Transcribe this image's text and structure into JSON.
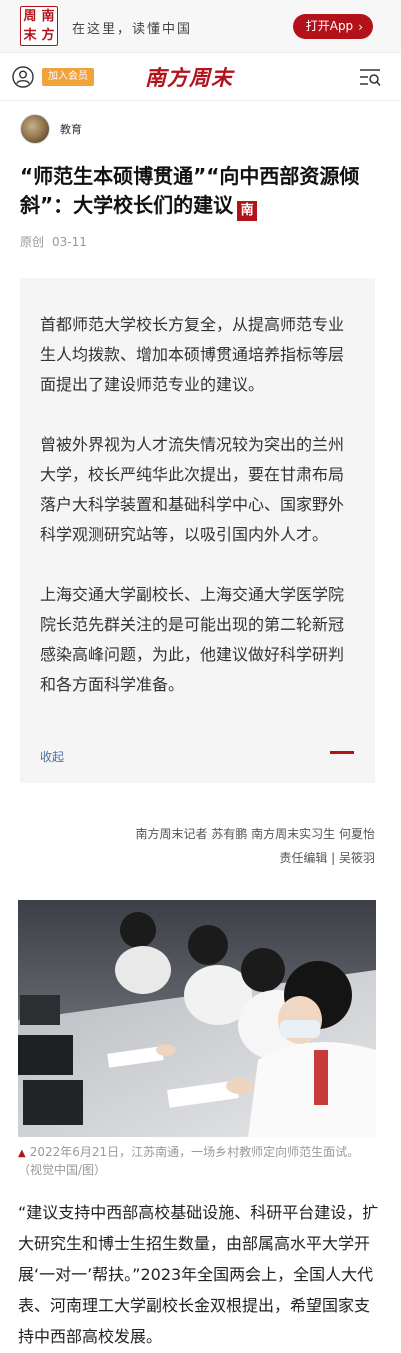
{
  "promo": {
    "logo_chars": [
      "周",
      "南",
      "末",
      "方"
    ],
    "slogan": "在这里，读懂中国",
    "open_app_label": "打开App"
  },
  "header": {
    "member_label": "加入会员",
    "brand": "南方周末"
  },
  "article": {
    "channel": "教育",
    "title": "“师范生本硕博贯通”“向中西部资源倾斜”：大学校长们的建议",
    "title_seal": "南",
    "original_label": "原创",
    "date": "03-11"
  },
  "summary": {
    "paragraphs": [
      "首都师范大学校长方复全，从提高师范专业生人均拨款、增加本硕博贯通培养指标等层面提出了建设师范专业的建议。",
      "曾被外界视为人才流失情况较为突出的兰州大学，校长严纯华此次提出，要在甘肃布局落户大科学装置和基础科学中心、国家野外科学观测研究站等，以吸引国内外人才。",
      "上海交通大学副校长、上海交通大学医学院院长范先群关注的是可能出现的第二轮新冠感染高峰问题，为此，他建议做好科学研判和各方面科学准备。"
    ],
    "collapse_label": "收起"
  },
  "credits": {
    "line1": "南方周末记者 苏有鹏 南方周末实习生 何夏怡",
    "line2": "责任编辑 | 吴筱羽"
  },
  "photo": {
    "caption": "2022年6月21日，江苏南通，一场乡村教师定向师范生面试。（视觉中国/图）"
  },
  "body": {
    "paragraph1": "“建议支持中西部高校基础设施、科研平台建设，扩大研究生和博士生招生数量，由部属高水平大学开展‘一对一’帮扶。”2023年全国两会上，全国人大代表、河南理工大学副校长金双根提出，希望国家支持中西部高校发展。"
  },
  "colors": {
    "brand_red": "#b3121b",
    "member_orange": "#f0a23b",
    "link_blue": "#4a6fa5",
    "summary_bg": "#f5f5f5"
  }
}
